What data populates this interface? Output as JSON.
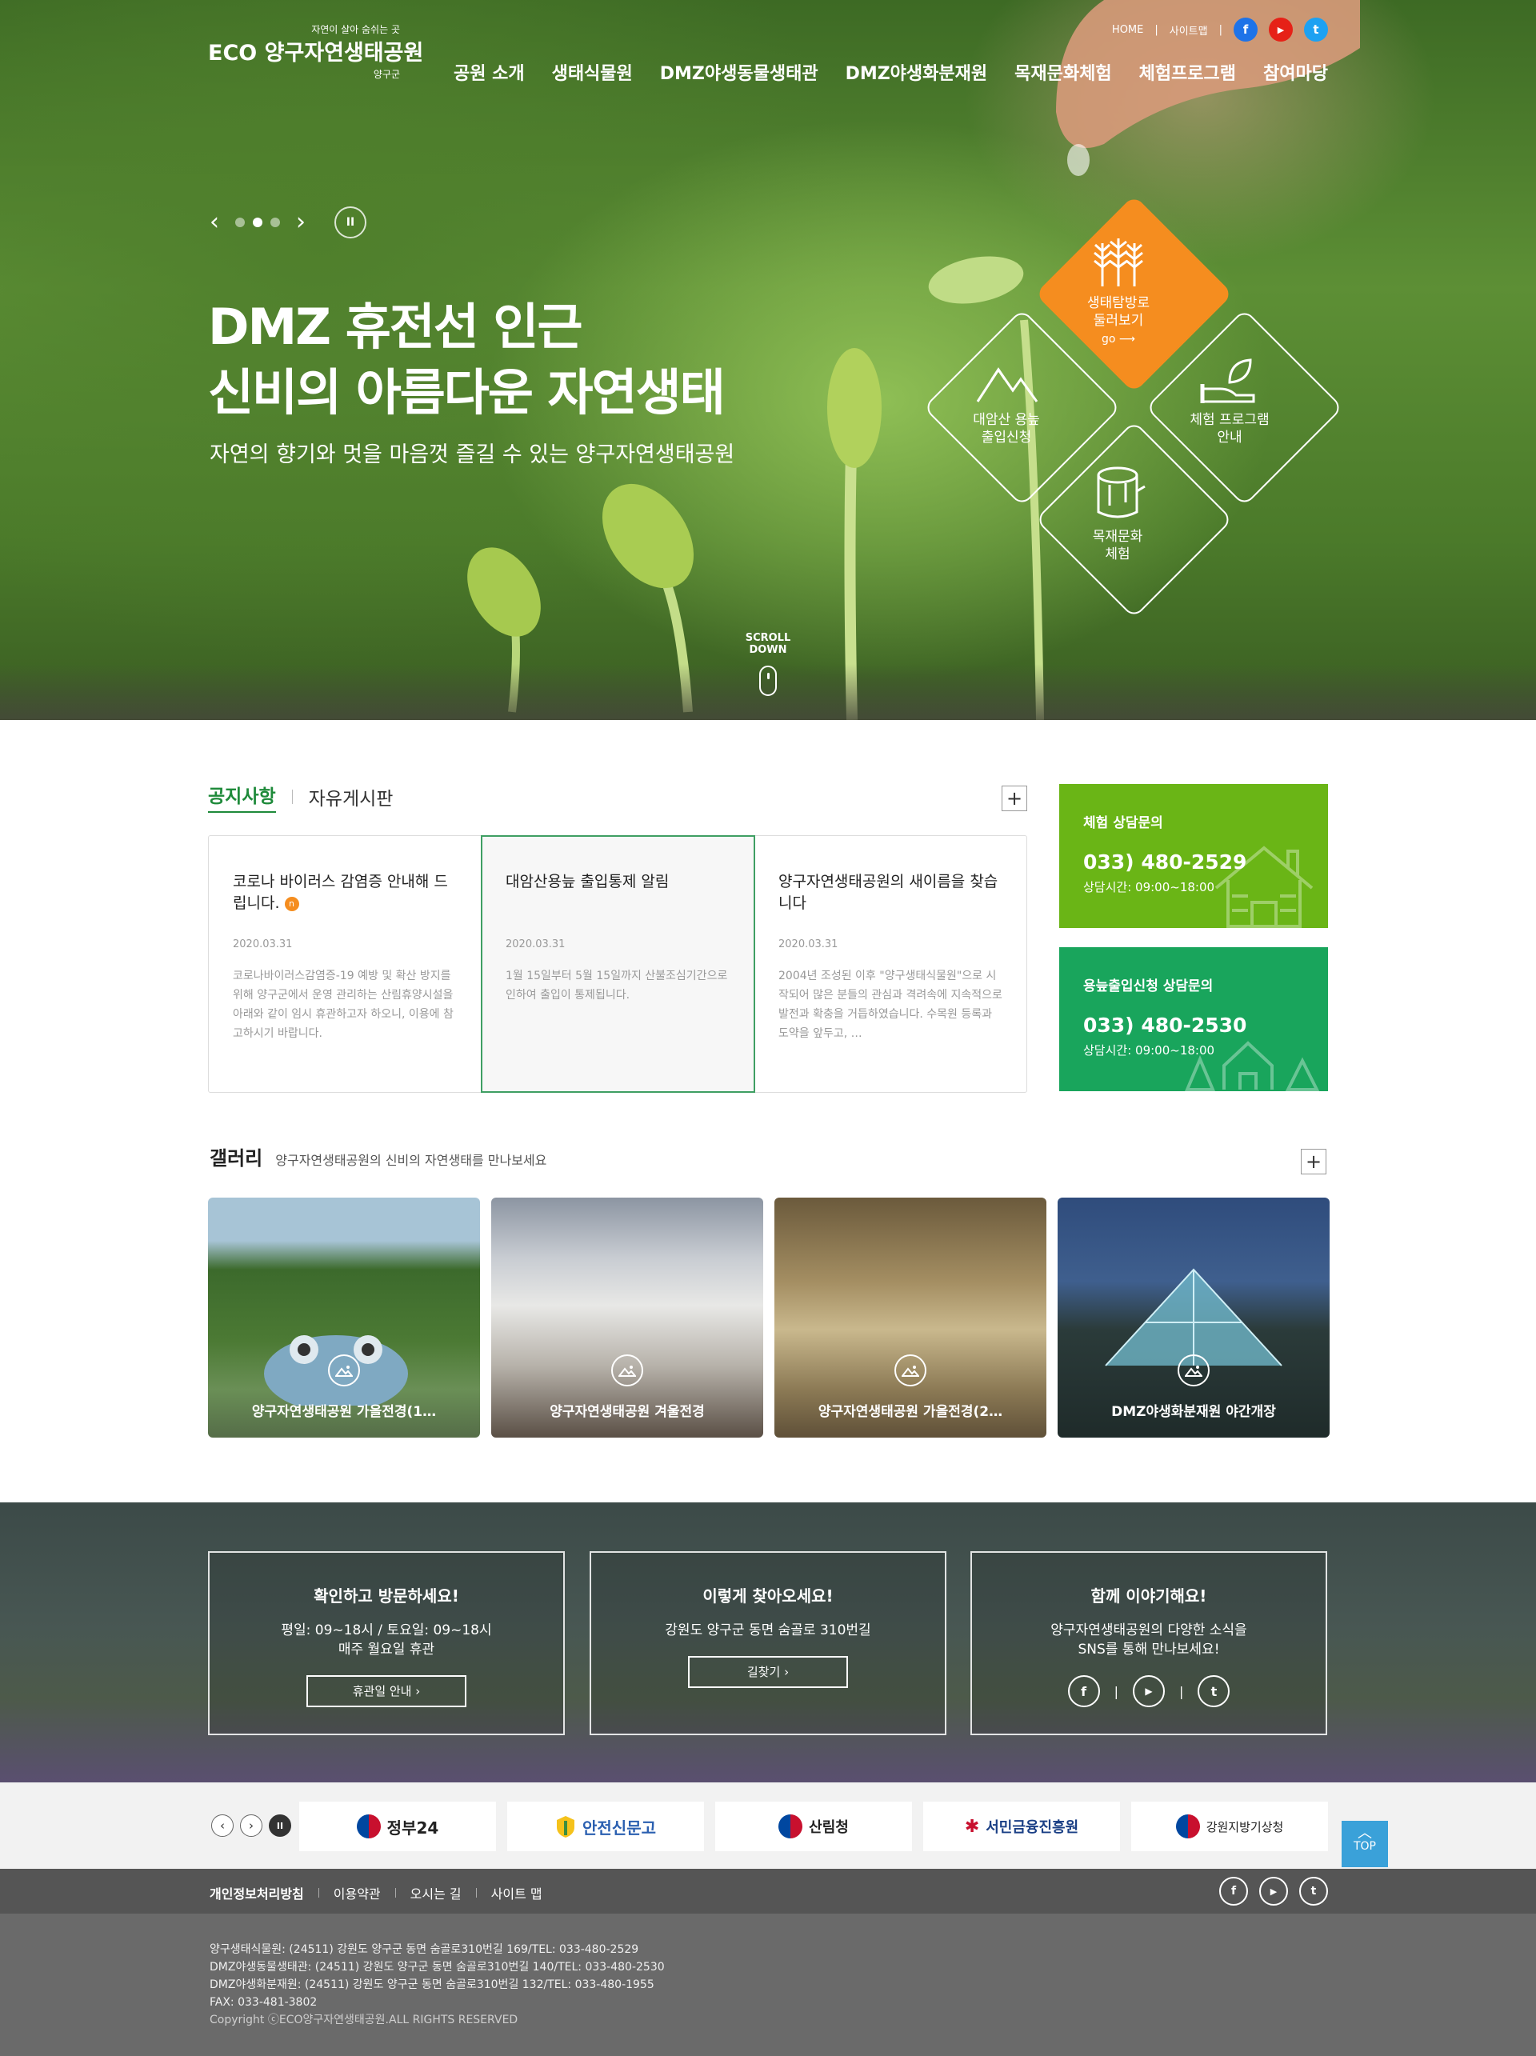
{
  "header": {
    "logo_tag": "자연이 살아 숨쉬는 곳",
    "logo_name": "ECO 양구자연생태공원",
    "logo_sub": "양구군",
    "util": {
      "home": "HOME",
      "sitemap": "사이트맵"
    },
    "sns": [
      {
        "name": "facebook",
        "glyph": "f",
        "color": "#1e73e8"
      },
      {
        "name": "youtube",
        "glyph": "▶",
        "color": "#e62117"
      },
      {
        "name": "twitter",
        "glyph": "t",
        "color": "#1da1f2"
      }
    ],
    "nav": [
      "공원 소개",
      "생태식물원",
      "DMZ야생동물생태관",
      "DMZ야생화분재원",
      "목재문화체험",
      "체험프로그램",
      "참여마당"
    ]
  },
  "hero": {
    "title_line1": "DMZ 휴전선 인근",
    "title_line2": "신비의 아름다운 자연생태",
    "subtitle": "자연의 향기와 멋을 마음껏 즐길 수 있는 양구자연생태공원",
    "scroll": "SCROLL DOWN",
    "slide_current": 2,
    "slide_total": 3,
    "quick": {
      "eco": {
        "label1": "생태탐방로",
        "label2": "둘러보기",
        "go": "go ⟶",
        "icon": "trees-icon"
      },
      "mountain": {
        "label1": "대암산 용늪",
        "label2": "출입신청",
        "icon": "mountain-icon"
      },
      "program": {
        "label1": "체험 프로그램",
        "label2": "안내",
        "icon": "hand-leaf-icon"
      },
      "wood": {
        "label1": "목재문화",
        "label2": "체험",
        "icon": "log-icon"
      }
    }
  },
  "notice": {
    "tab_active": "공지사항",
    "tab_other": "자유게시판",
    "plus": "+",
    "items": [
      {
        "title": "코로나 바이러스 감염증 안내해 드립니다.",
        "badge": "n",
        "date": "2020.03.31",
        "summary": "코로나바이러스감염증-19 예방 및 확산 방지를 위해 양구군에서 운영 관리하는 산림휴양시설을 아래와 같이 임시 휴관하고자 하오니, 이용에 참고하시기 바랍니다."
      },
      {
        "title": "대암산용늪 출입통제 알림",
        "badge": "",
        "date": "2020.03.31",
        "summary": "1월 15일부터 5월 15일까지 산불조심기간으로 인하여 출입이 통제됩니다."
      },
      {
        "title": "양구자연생태공원의 새이름을 찾습니다",
        "badge": "",
        "date": "2020.03.31",
        "summary": "2004년 조성된 이후 \"양구생태식물원\"으로 시작되어 많은 분들의 관심과 격려속에 지속적으로 발전과 확충을 거듭하였습니다. 수목원 등록과 도약을 앞두고, …"
      }
    ]
  },
  "contacts": [
    {
      "title": "체험 상담문의",
      "phone": "033) 480-2529",
      "hours": "상담시간: 09:00~18:00",
      "color": "#6ab516"
    },
    {
      "title": "용늪출입신청 상담문의",
      "phone": "033) 480-2530",
      "hours": "상담시간: 09:00~18:00",
      "color": "#19a55c"
    }
  ],
  "gallery": {
    "title": "갤러리",
    "subtitle": "양구자연생태공원의 신비의 자연생태를 만나보세요",
    "items": [
      {
        "caption": "양구자연생태공원 가을전경(1…"
      },
      {
        "caption": "양구자연생태공원 겨울전경"
      },
      {
        "caption": "양구자연생태공원 가을전경(2…"
      },
      {
        "caption": "DMZ야생화분재원 야간개장"
      }
    ]
  },
  "info": [
    {
      "title": "확인하고 방문하세요!",
      "line1": "평일: 09~18시 / 토요일: 09~18시",
      "line2": "매주 월요일 휴관",
      "button": "휴관일 안내 ›"
    },
    {
      "title": "이렇게 찾아오세요!",
      "line1": "강원도 양구군 동면 숨골로 310번길",
      "line2": "",
      "button": "길찾기 ›"
    },
    {
      "title": "함께 이야기해요!",
      "line1": "양구자연생태공원의 다양한 소식을",
      "line2": "SNS를 통해 만나보세요!",
      "sns": [
        "f",
        "▶",
        "t"
      ]
    }
  ],
  "banners": [
    "정부24",
    "안전신문고",
    "산림청",
    "서민금융진흥원",
    "강원지방기상청"
  ],
  "top": "TOP",
  "footer": {
    "links": [
      "개인정보처리방침",
      "이용약관",
      "오시는 길",
      "사이트 맵"
    ],
    "sns": [
      "f",
      "▶",
      "t"
    ],
    "address": [
      "양구생태식물원: (24511) 강원도 양구군 동면 숨골로310번길 169/TEL: 033-480-2529",
      "DMZ야생동물생태관: (24511) 강원도 양구군 동면 숨골로310번길 140/TEL: 033-480-2530",
      "DMZ야생화분재원: (24511) 강원도 양구군 동면 숨골로310번길 132/TEL: 033-480-1955",
      "FAX: 033-481-3802"
    ],
    "copyright": "Copyright ⓒECO양구자연생태공원.ALL RIGHTS RESERVED"
  }
}
